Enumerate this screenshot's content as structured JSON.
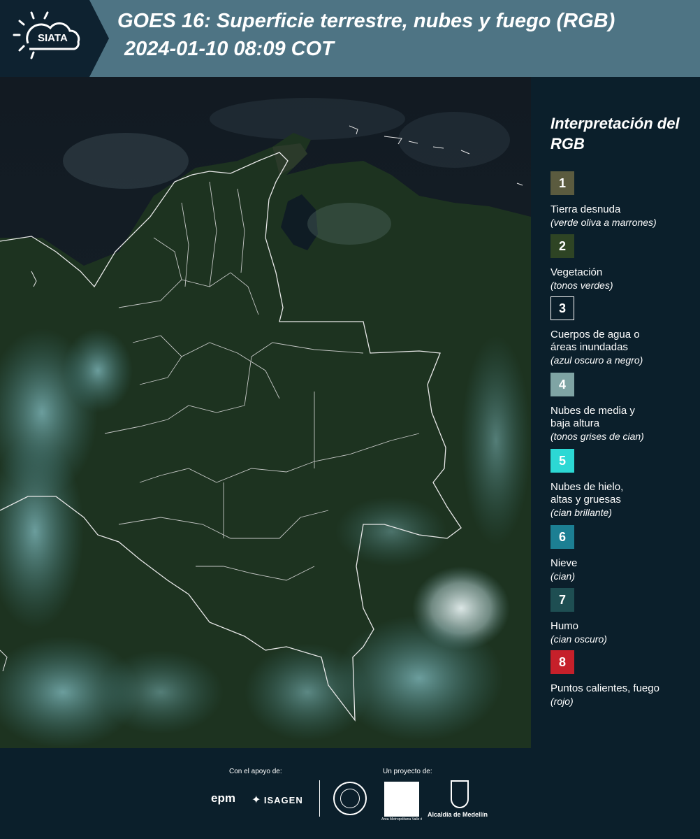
{
  "header": {
    "logo_text": "SIATA",
    "title_line1": "GOES 16: Superficie terrestre, nubes y fuego (RGB)",
    "title_line2": "2024-01-10 08:09 COT"
  },
  "legend": {
    "title": "Interpretación del RGB",
    "items": [
      {
        "number": "1",
        "label": "Tierra desnuda",
        "desc": "(verde oliva a marrones)",
        "color": "#5b5b3f"
      },
      {
        "number": "2",
        "label": "Vegetación",
        "desc": "(tonos verdes)",
        "color": "#2e4424"
      },
      {
        "number": "3",
        "label": "Cuerpos de agua o áreas inundadas",
        "desc": "(azul oscuro a negro)",
        "color": "#0b1f2b"
      },
      {
        "number": "4",
        "label": "Nubes de media y baja altura",
        "desc": "(tonos grises de cian)",
        "color": "#7fa4a4"
      },
      {
        "number": "5",
        "label": "Nubes de hielo, altas y gruesas",
        "desc": "(cian brillante)",
        "color": "#2cd8d4"
      },
      {
        "number": "6",
        "label": "Nieve",
        "desc": "(cian)",
        "color": "#1c7f93"
      },
      {
        "number": "7",
        "label": "Humo",
        "desc": "(cian oscuro)",
        "color": "#1e4e52"
      },
      {
        "number": "8",
        "label": "Puntos calientes, fuego",
        "desc": "(rojo)",
        "color": "#c6202a"
      }
    ]
  },
  "footer": {
    "support_label": "Con el apoyo de:",
    "project_label": "Un proyecto de:",
    "partners": [
      "epm",
      "ISAGEN",
      "Área Metropolitana Valle de Aburrá",
      "Alcaldía de Medellín"
    ]
  }
}
